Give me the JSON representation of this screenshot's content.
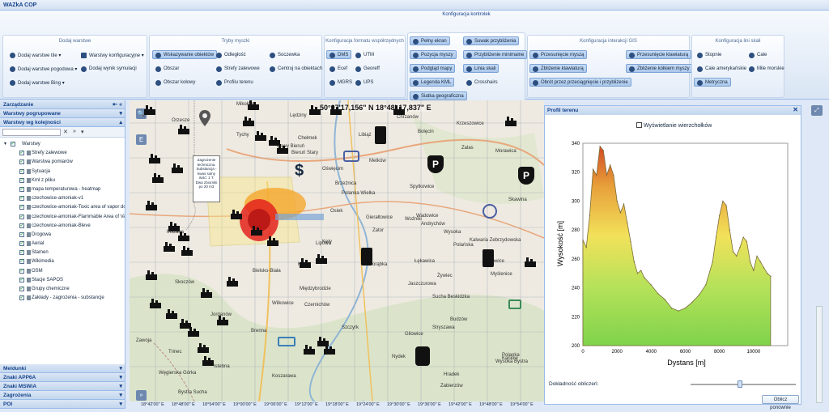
{
  "window": {
    "title": "WAZkA COP"
  },
  "ribbon": {
    "top_tab": "Konfiguracja kontrolek",
    "groups": [
      {
        "title": "Dodaj warstwe",
        "buttons": [
          "Dodaj warstwe tile",
          "Warstwy konfiguracyjne",
          "Dodaj warstwe pogodowa",
          "Dodaj wynik symulacji",
          "Dodaj warstwe Bing"
        ]
      },
      {
        "title": "Tryby myszki",
        "buttons": [
          "Wskazywanie obiektów",
          "Odległość",
          "Soczewka",
          "Obszar",
          "Strefy zalewowe",
          "Centruj na obiektach",
          "Obszar kołowy",
          "Profilu terenu"
        ]
      },
      {
        "title": "Konfiguracja formatu współrzędnych",
        "buttons": [
          "DMS",
          "UTM",
          "Ecef",
          "Georeff",
          "MGRS",
          "UPS"
        ]
      },
      {
        "title": "",
        "buttons": [
          "Pełny ekran",
          "Suwak przybliżenia",
          "Pozycja myszy",
          "Przybliżenie minimalne",
          "Podgląd mapy",
          "Linia skali",
          "Legenda KML",
          "Crosshairs",
          "Siatka geograficzna"
        ]
      },
      {
        "title": "Konfiguracja interakcji GIS",
        "buttons": [
          "Przesunięcie myszą",
          "Przesunięcie klawiaturą",
          "Zbliżenie klawiaturą",
          "Zbliżenie kółkiem myszy",
          "Obrót przez przeciągnięcie i przybliżenie"
        ]
      },
      {
        "title": "Konfiguracja lini skali",
        "buttons": [
          "Stopnie",
          "Cale",
          "Cale amerykańskie",
          "Mile morskie",
          "Metryczna"
        ]
      }
    ]
  },
  "left_panel": {
    "accordions_top": [
      "Zarządzanie",
      "Warstwy pogrupowane",
      "Warstwy wg kolejności"
    ],
    "search_placeholder": "",
    "tree_root": "Warstwy",
    "layers": [
      "Strefy zalewowe",
      "Warstwa pomiarów",
      "Sytuacja",
      "Kml z pliku",
      "mapa temperaturowa - heatmap",
      "czechowice-amoniak-v1",
      "czechowice-amoniak-Toxic area of vapor do",
      "czechowice-amoniak-Flammable Area of Vap",
      "czechowice-amoniak-Bleve",
      "Drogowa",
      "Aerial",
      "Stamen",
      "Wikimedia",
      "OSM",
      "Stacje SAPOS",
      "Grupy chemiczne",
      "Zakłady - zagrożenia - substancje"
    ],
    "accordions_bottom": [
      "Meldunki",
      "Znaki APP6A",
      "Znaki MSWiA",
      "Zagrożenia",
      "POI"
    ]
  },
  "map": {
    "coordinate_readout": "50°07'17,156\" N 18°48' 17,837\" E",
    "popup_text": "Zagrożenie techniczna. Substancja - kwas solny ilość: 1 T. Dwa zbiorniki po 20 m3",
    "places": [
      "Mikołów",
      "Orzesze",
      "Tychy",
      "Lędziny",
      "Chełmek",
      "Libiąż",
      "Bolęcin",
      "Krzeszowice",
      "Chrzanów",
      "Zalas",
      "Morawica",
      "Nowy Bieruń",
      "Bieruń Stary",
      "Oświęcim",
      "Metków",
      "Brzeźnica",
      "Spytkowice",
      "Polanka Wielka",
      "Skawina",
      "Wadowice",
      "Kalwaria Zebrzydowska",
      "Gierałtowice",
      "Woźniki",
      "Osiek",
      "Kęty",
      "Andrychów",
      "Wysoka",
      "Zator",
      "Bielsko-Biała",
      "Kozy",
      "Porąbka",
      "Łękawica",
      "Sułkowice",
      "Myślenice",
      "Jaszczurowa",
      "Sucha Beskidzka",
      "Skoczów",
      "Międzybrodzie",
      "Wilkowice",
      "Czernichów",
      "Stryszawa",
      "Budzów",
      "Jordanów",
      "Brenna",
      "Szczyrk",
      "Gilowice",
      "Zawoja",
      "Trinec",
      "Nydek",
      "Koszarawa",
      "Węgierska Górka",
      "Hradek",
      "Istebna",
      "Żywiec",
      "Mszana",
      "Zabierzów",
      "Lipowa",
      "Polańska",
      "Polanka",
      "Kaniów",
      "Wysoka Bystra",
      "Bystra Sucha"
    ],
    "bottom_axis": [
      "18°42'00\" E",
      "18°48'00\" E",
      "18°54'00\" E",
      "19°00'00\" E",
      "19°06'00\" E",
      "19°12'00\" E",
      "19°18'00\" E",
      "19°24'00\" E",
      "19°30'00\" E",
      "19°36'00\" E",
      "19°42'00\" E",
      "19°48'00\" E",
      "19°54'00\" E"
    ]
  },
  "profile_panel": {
    "title": "Profil terenu",
    "checkbox_label": "Wyświetlanie wierzchołków",
    "precision_label": "Dokładność obliczeń:",
    "calc_button": "Oblicz ponownie"
  },
  "chart_data": {
    "type": "area",
    "xlabel": "Dystans [m]",
    "ylabel": "Wysokość [m]",
    "xlim": [
      0,
      12000
    ],
    "ylim": [
      200,
      340
    ],
    "x_ticks": [
      0,
      2000,
      4000,
      6000,
      8000,
      10000
    ],
    "y_ticks": [
      200,
      220,
      240,
      260,
      280,
      300,
      320,
      340
    ],
    "x": [
      0,
      200,
      400,
      600,
      800,
      1000,
      1200,
      1400,
      1600,
      1800,
      2000,
      2200,
      2400,
      2600,
      2800,
      3000,
      3200,
      3400,
      3600,
      4000,
      4400,
      4800,
      5200,
      5600,
      6000,
      6400,
      6800,
      7200,
      7600,
      7800,
      8000,
      8200,
      8400,
      8600,
      8800,
      9000,
      9200,
      9400,
      9600,
      9800,
      10000,
      10200,
      10400,
      10600,
      10800,
      11000
    ],
    "values": [
      273,
      268,
      290,
      322,
      318,
      338,
      335,
      318,
      325,
      318,
      300,
      292,
      298,
      285,
      272,
      258,
      250,
      252,
      247,
      242,
      236,
      232,
      226,
      224,
      226,
      230,
      235,
      242,
      258,
      275,
      290,
      300,
      297,
      280,
      265,
      262,
      268,
      275,
      272,
      258,
      252,
      262,
      258,
      254,
      250,
      248
    ],
    "fill_gradient": [
      "#d34a25",
      "#e7a03a",
      "#f2e15a",
      "#b6e25a",
      "#7fd34a"
    ]
  }
}
